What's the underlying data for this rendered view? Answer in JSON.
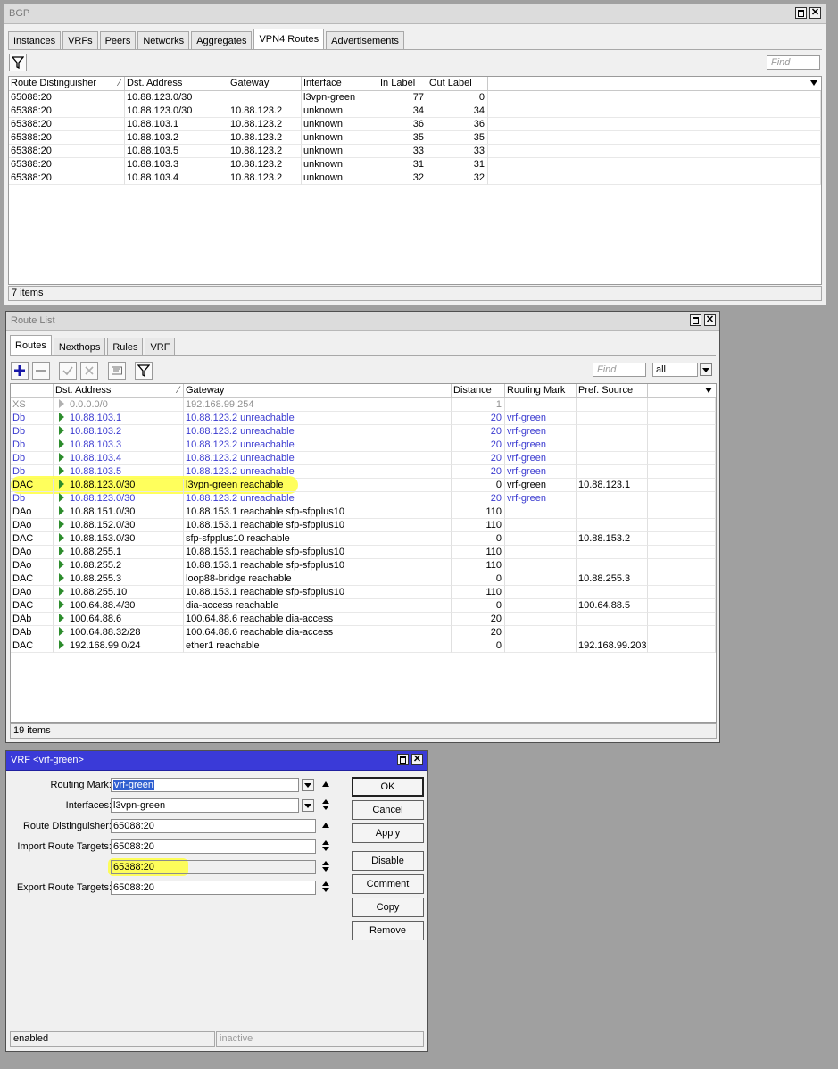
{
  "bgp": {
    "title": "BGP",
    "tabs": [
      "Instances",
      "VRFs",
      "Peers",
      "Networks",
      "Aggregates",
      "VPN4 Routes",
      "Advertisements"
    ],
    "selected_tab": 5,
    "find_placeholder": "Find",
    "columns": [
      "Route Distinguisher",
      "Dst. Address",
      "Gateway",
      "Interface",
      "In Label",
      "Out Label"
    ],
    "rows": [
      [
        "65088:20",
        "10.88.123.0/30",
        "",
        "l3vpn-green",
        "77",
        "0"
      ],
      [
        "65388:20",
        "10.88.123.0/30",
        "10.88.123.2",
        "unknown",
        "34",
        "34"
      ],
      [
        "65388:20",
        "10.88.103.1",
        "10.88.123.2",
        "unknown",
        "36",
        "36"
      ],
      [
        "65388:20",
        "10.88.103.2",
        "10.88.123.2",
        "unknown",
        "35",
        "35"
      ],
      [
        "65388:20",
        "10.88.103.5",
        "10.88.123.2",
        "unknown",
        "33",
        "33"
      ],
      [
        "65388:20",
        "10.88.103.3",
        "10.88.123.2",
        "unknown",
        "31",
        "31"
      ],
      [
        "65388:20",
        "10.88.103.4",
        "10.88.123.2",
        "unknown",
        "32",
        "32"
      ]
    ],
    "status": "7 items"
  },
  "routes": {
    "title": "Route List",
    "tabs": [
      "Routes",
      "Nexthops",
      "Rules",
      "VRF"
    ],
    "selected_tab": 0,
    "find_placeholder": "Find",
    "filter_value": "all",
    "columns": [
      "",
      "Dst. Address",
      "Gateway",
      "Distance",
      "Routing Mark",
      "Pref. Source"
    ],
    "rows": [
      {
        "flags": "XS",
        "dst": "0.0.0.0/0",
        "gw": "192.168.99.254",
        "dist": "1",
        "mark": "",
        "pref": "",
        "style": "gray"
      },
      {
        "flags": "Db",
        "dst": "10.88.103.1",
        "gw": "10.88.123.2 unreachable",
        "dist": "20",
        "mark": "vrf-green",
        "pref": "",
        "style": "blue"
      },
      {
        "flags": "Db",
        "dst": "10.88.103.2",
        "gw": "10.88.123.2 unreachable",
        "dist": "20",
        "mark": "vrf-green",
        "pref": "",
        "style": "blue"
      },
      {
        "flags": "Db",
        "dst": "10.88.103.3",
        "gw": "10.88.123.2 unreachable",
        "dist": "20",
        "mark": "vrf-green",
        "pref": "",
        "style": "blue"
      },
      {
        "flags": "Db",
        "dst": "10.88.103.4",
        "gw": "10.88.123.2 unreachable",
        "dist": "20",
        "mark": "vrf-green",
        "pref": "",
        "style": "blue"
      },
      {
        "flags": "Db",
        "dst": "10.88.103.5",
        "gw": "10.88.123.2 unreachable",
        "dist": "20",
        "mark": "vrf-green",
        "pref": "",
        "style": "blue"
      },
      {
        "flags": "DAC",
        "dst": "10.88.123.0/30",
        "gw": "l3vpn-green reachable",
        "dist": "0",
        "mark": "vrf-green",
        "pref": "10.88.123.1",
        "style": "normal"
      },
      {
        "flags": "Db",
        "dst": "10.88.123.0/30",
        "gw": "10.88.123.2 unreachable",
        "dist": "20",
        "mark": "vrf-green",
        "pref": "",
        "style": "blue"
      },
      {
        "flags": "DAo",
        "dst": "10.88.151.0/30",
        "gw": "10.88.153.1 reachable sfp-sfpplus10",
        "dist": "110",
        "mark": "",
        "pref": "",
        "style": "normal"
      },
      {
        "flags": "DAo",
        "dst": "10.88.152.0/30",
        "gw": "10.88.153.1 reachable sfp-sfpplus10",
        "dist": "110",
        "mark": "",
        "pref": "",
        "style": "normal"
      },
      {
        "flags": "DAC",
        "dst": "10.88.153.0/30",
        "gw": "sfp-sfpplus10 reachable",
        "dist": "0",
        "mark": "",
        "pref": "10.88.153.2",
        "style": "normal"
      },
      {
        "flags": "DAo",
        "dst": "10.88.255.1",
        "gw": "10.88.153.1 reachable sfp-sfpplus10",
        "dist": "110",
        "mark": "",
        "pref": "",
        "style": "normal"
      },
      {
        "flags": "DAo",
        "dst": "10.88.255.2",
        "gw": "10.88.153.1 reachable sfp-sfpplus10",
        "dist": "110",
        "mark": "",
        "pref": "",
        "style": "normal"
      },
      {
        "flags": "DAC",
        "dst": "10.88.255.3",
        "gw": "loop88-bridge reachable",
        "dist": "0",
        "mark": "",
        "pref": "10.88.255.3",
        "style": "normal"
      },
      {
        "flags": "DAo",
        "dst": "10.88.255.10",
        "gw": "10.88.153.1 reachable sfp-sfpplus10",
        "dist": "110",
        "mark": "",
        "pref": "",
        "style": "normal"
      },
      {
        "flags": "DAC",
        "dst": "100.64.88.4/30",
        "gw": "dia-access reachable",
        "dist": "0",
        "mark": "",
        "pref": "100.64.88.5",
        "style": "normal"
      },
      {
        "flags": "DAb",
        "dst": "100.64.88.6",
        "gw": "100.64.88.6 reachable dia-access",
        "dist": "20",
        "mark": "",
        "pref": "",
        "style": "normal"
      },
      {
        "flags": "DAb",
        "dst": "100.64.88.32/28",
        "gw": "100.64.88.6 reachable dia-access",
        "dist": "20",
        "mark": "",
        "pref": "",
        "style": "normal"
      },
      {
        "flags": "DAC",
        "dst": "192.168.99.0/24",
        "gw": "ether1 reachable",
        "dist": "0",
        "mark": "",
        "pref": "192.168.99.203",
        "style": "normal"
      }
    ],
    "status": "19 items"
  },
  "vrf": {
    "title": "VRF <vrf-green>",
    "labels": {
      "routing_mark": "Routing Mark:",
      "interfaces": "Interfaces:",
      "route_distinguisher": "Route Distinguisher:",
      "import_route_targets": "Import Route Targets:",
      "export_route_targets": "Export Route Targets:"
    },
    "values": {
      "routing_mark": "vrf-green",
      "interfaces": "l3vpn-green",
      "route_distinguisher": "65088:20",
      "import_route_targets_1": "65088:20",
      "import_route_targets_2": "65388:20",
      "export_route_targets": "65088:20"
    },
    "buttons": [
      "OK",
      "Cancel",
      "Apply",
      "Disable",
      "Comment",
      "Copy",
      "Remove"
    ],
    "status_left": "enabled",
    "status_right": "inactive"
  },
  "colors": {
    "highlight": "#ffff40",
    "link_blue": "#3a3ad0",
    "active_title": "#3a3ad8",
    "route_arrow": "#2c8c2c"
  }
}
